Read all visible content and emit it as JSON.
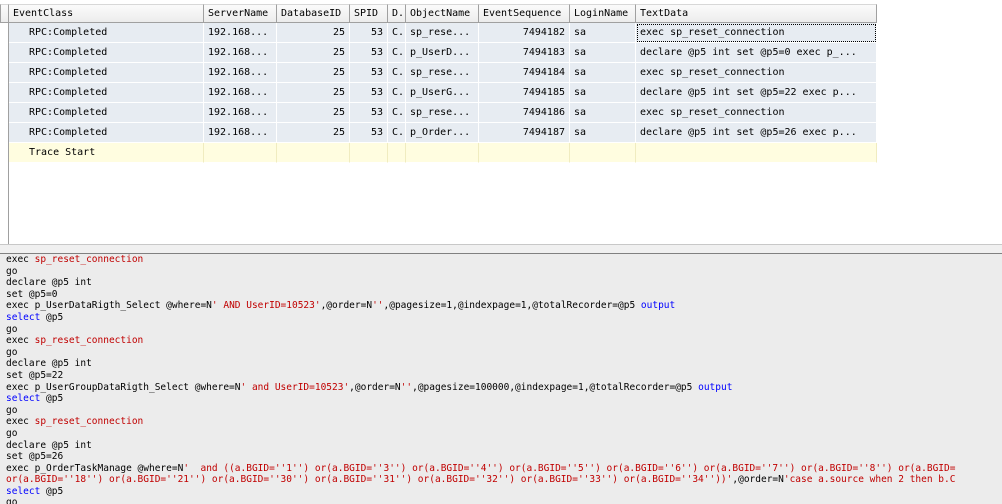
{
  "grid": {
    "columns": [
      "EventClass",
      "ServerName",
      "DatabaseID",
      "SPID",
      "D.",
      "ObjectName",
      "EventSequence",
      "LoginName",
      "TextData"
    ],
    "rows": [
      [
        "RPC:Completed",
        "192.168...",
        "25",
        "53",
        "C.",
        "sp_rese...",
        "7494182",
        "sa",
        "exec sp_reset_connection"
      ],
      [
        "RPC:Completed",
        "192.168...",
        "25",
        "53",
        "C.",
        "p_UserD...",
        "7494183",
        "sa",
        "declare @p5 int  set @p5=0  exec p_..."
      ],
      [
        "RPC:Completed",
        "192.168...",
        "25",
        "53",
        "C.",
        "sp_rese...",
        "7494184",
        "sa",
        "exec sp_reset_connection"
      ],
      [
        "RPC:Completed",
        "192.168...",
        "25",
        "53",
        "C.",
        "p_UserG...",
        "7494185",
        "sa",
        "declare @p5 int  set @p5=22  exec p..."
      ],
      [
        "RPC:Completed",
        "192.168...",
        "25",
        "53",
        "C.",
        "sp_rese...",
        "7494186",
        "sa",
        "exec sp_reset_connection"
      ],
      [
        "RPC:Completed",
        "192.168...",
        "25",
        "53",
        "C.",
        "p_Order...",
        "7494187",
        "sa",
        "declare @p5 int  set @p5=26  exec p..."
      ]
    ],
    "trace_row_label": "Trace Start"
  },
  "text_lines": [
    [
      {
        "t": "exec "
      },
      {
        "t": "sp_reset_connection",
        "c": "red"
      }
    ],
    [
      {
        "t": "go"
      }
    ],
    [
      {
        "t": "declare @p5 int"
      }
    ],
    [
      {
        "t": "set @p5=0"
      }
    ],
    [
      {
        "t": "exec p_UserDataRigth_Select @where=N"
      },
      {
        "t": "' AND UserID=10523'",
        "c": "red"
      },
      {
        "t": ",@order=N"
      },
      {
        "t": "''",
        "c": "red"
      },
      {
        "t": ",@pagesize=1,@indexpage=1,@totalRecorder=@p5 "
      },
      {
        "t": "output",
        "c": "blue"
      }
    ],
    [
      {
        "t": "select",
        "c": "blue"
      },
      {
        "t": " @p5"
      }
    ],
    [
      {
        "t": "go"
      }
    ],
    [
      {
        "t": "exec "
      },
      {
        "t": "sp_reset_connection",
        "c": "red"
      }
    ],
    [
      {
        "t": "go"
      }
    ],
    [
      {
        "t": "declare @p5 int"
      }
    ],
    [
      {
        "t": "set @p5=22"
      }
    ],
    [
      {
        "t": "exec p_UserGroupDataRigth_Select @where=N"
      },
      {
        "t": "' and UserID=10523'",
        "c": "red"
      },
      {
        "t": ",@order=N"
      },
      {
        "t": "''",
        "c": "red"
      },
      {
        "t": ",@pagesize=100000,@indexpage=1,@totalRecorder=@p5 "
      },
      {
        "t": "output",
        "c": "blue"
      }
    ],
    [
      {
        "t": "select",
        "c": "blue"
      },
      {
        "t": " @p5"
      }
    ],
    [
      {
        "t": "go"
      }
    ],
    [
      {
        "t": "exec "
      },
      {
        "t": "sp_reset_connection",
        "c": "red"
      }
    ],
    [
      {
        "t": "go"
      }
    ],
    [
      {
        "t": "declare @p5 int"
      }
    ],
    [
      {
        "t": "set @p5=26"
      }
    ],
    [
      {
        "t": "exec p_OrderTaskManage @where=N"
      },
      {
        "t": "'  and ((a.BGID=''1'') or(a.BGID=''3'') or(a.BGID=''4'') or(a.BGID=''5'') or(a.BGID=''6'') or(a.BGID=''7'') or(a.BGID=''8'') or(a.BGID=",
        "c": "red"
      }
    ],
    [
      {
        "t": "or(a.BGID=''18'') or(a.BGID=''21'') or(a.BGID=''30'') or(a.BGID=''31'') or(a.BGID=''32'') or(a.BGID=''33'') or(a.BGID=''34''))'",
        "c": "red"
      },
      {
        "t": ",@order=N"
      },
      {
        "t": "'case a.source when 2 then b.C",
        "c": "red"
      }
    ],
    [
      {
        "t": "select",
        "c": "blue"
      },
      {
        "t": " @p5"
      }
    ],
    [
      {
        "t": "go"
      }
    ]
  ],
  "colors": {
    "keyword_blue": "#0000ff",
    "string_red": "#c00000",
    "row_bg": "#e7ecf2",
    "trace_bg": "#fffde0",
    "pane_bg": "#ececec"
  }
}
